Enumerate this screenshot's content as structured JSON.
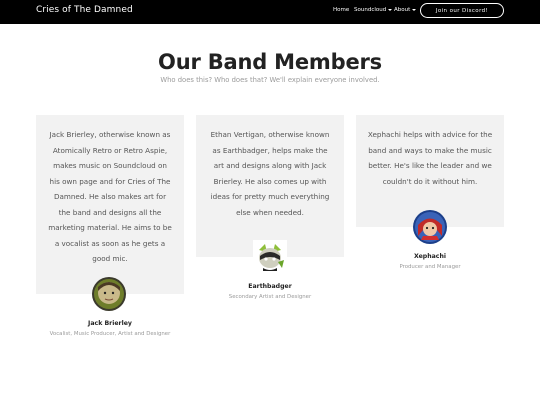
{
  "navbar": {
    "brand": "Cries of The Damned",
    "links": [
      {
        "label": "Home"
      },
      {
        "label": "Soundcloud",
        "dropdown": true
      },
      {
        "label": "About",
        "dropdown": true
      }
    ],
    "cta_label": "Join our Discord!"
  },
  "section": {
    "title": "Our Band Members",
    "subtitle": "Who does this? Who does that? We'll explain everyone involved."
  },
  "members": [
    {
      "bio": "Jack Brierley, otherwise known as Atomically Retro or Retro Aspie, makes music on Soundcloud on his own page and for Cries of The Damned. He also makes art for the band and designs all the marketing material. He aims to be a vocalist as soon as he gets a good mic.",
      "name": "Jack Brierley",
      "role": "Vocalist, Music Producer, Artist and Designer"
    },
    {
      "bio": "Ethan Vertigan, otherwise known as Earthbadger, helps make the art and designs along with Jack Brierley. He also comes up with ideas for pretty much everything else when needed.",
      "name": "Earthbadger",
      "role": "Secondary Artist and Designer"
    },
    {
      "bio": "Xephachi helps with advice for the band and ways to make the music better. He's like the leader and we couldn't do it without him.",
      "name": "Xephachi",
      "role": "Producer and Manager"
    }
  ],
  "colors": {
    "navbar_bg": "#000000",
    "card_bg": "#f2f2f2",
    "muted_text": "#9a9a9a"
  }
}
